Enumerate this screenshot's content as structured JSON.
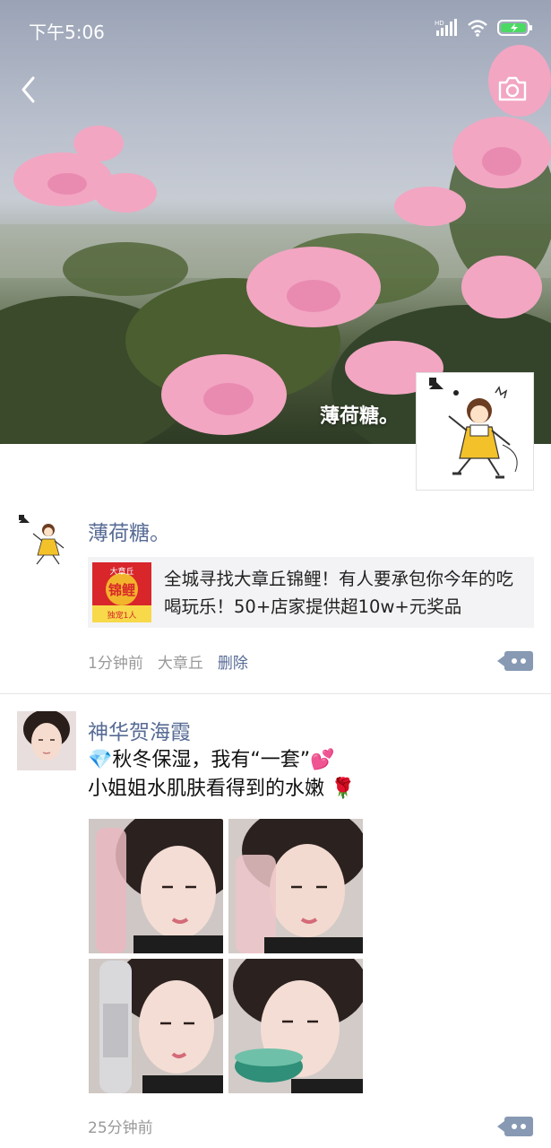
{
  "status_bar": {
    "time": "下午5:06",
    "hd_label": "HD"
  },
  "profile": {
    "name": "薄荷糖。"
  },
  "posts": [
    {
      "author": "薄荷糖。",
      "share": {
        "text": "全城寻找大章丘锦鲤！有人要承包你今年的吃喝玩乐！50+店家提供超10w+元奖品",
        "thumb_title": "锦鲤",
        "thumb_top": "大章丘",
        "thumb_sub": "独宠1人"
      },
      "time": "1分钟前",
      "location": "大章丘",
      "delete_label": "删除"
    },
    {
      "author": "神华贺海霞",
      "line1": "💎秋冬保湿，我有“一套”💕",
      "line2": "小姐姐水肌肤看得到的水嫩 🌹",
      "time": "25分钟前"
    }
  ],
  "colors": {
    "link": "#576b95",
    "meta": "#999999",
    "accent_battery": "#4cd964"
  }
}
